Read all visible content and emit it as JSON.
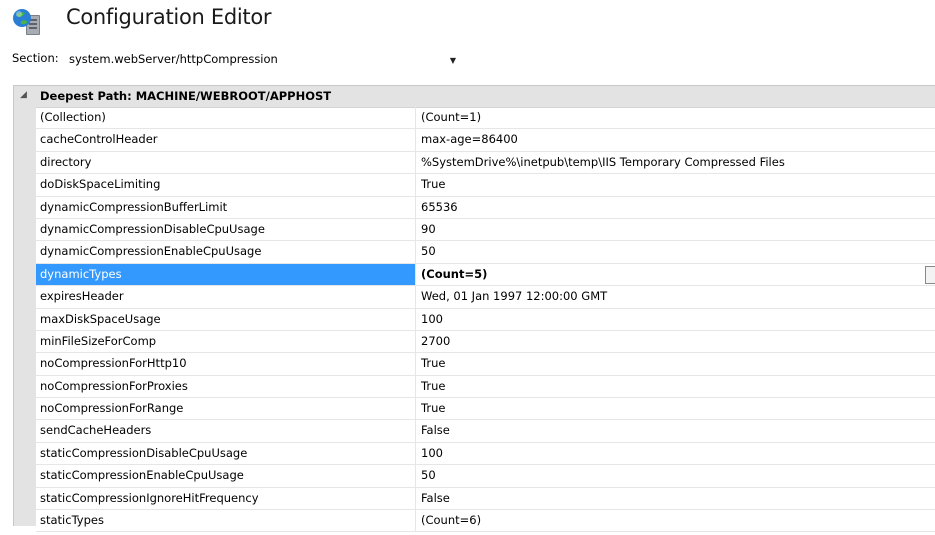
{
  "header": {
    "title": "Configuration Editor",
    "icon": "iis-config-icon"
  },
  "section": {
    "label": "Section:",
    "value": "system.webServer/httpCompression"
  },
  "grid": {
    "group": {
      "label": "Deepest Path: MACHINE/WEBROOT/APPHOST"
    },
    "selected_index": 7,
    "rows": [
      {
        "name": "(Collection)",
        "value": "(Count=1)"
      },
      {
        "name": "cacheControlHeader",
        "value": "max-age=86400"
      },
      {
        "name": "directory",
        "value": "%SystemDrive%\\inetpub\\temp\\IIS Temporary Compressed Files"
      },
      {
        "name": "doDiskSpaceLimiting",
        "value": "True"
      },
      {
        "name": "dynamicCompressionBufferLimit",
        "value": "65536"
      },
      {
        "name": "dynamicCompressionDisableCpuUsage",
        "value": "90"
      },
      {
        "name": "dynamicCompressionEnableCpuUsage",
        "value": "50"
      },
      {
        "name": "dynamicTypes",
        "value": "(Count=5)"
      },
      {
        "name": "expiresHeader",
        "value": "Wed, 01 Jan 1997 12:00:00 GMT"
      },
      {
        "name": "maxDiskSpaceUsage",
        "value": "100"
      },
      {
        "name": "minFileSizeForComp",
        "value": "2700"
      },
      {
        "name": "noCompressionForHttp10",
        "value": "True"
      },
      {
        "name": "noCompressionForProxies",
        "value": "True"
      },
      {
        "name": "noCompressionForRange",
        "value": "True"
      },
      {
        "name": "sendCacheHeaders",
        "value": "False"
      },
      {
        "name": "staticCompressionDisableCpuUsage",
        "value": "100"
      },
      {
        "name": "staticCompressionEnableCpuUsage",
        "value": "50"
      },
      {
        "name": "staticCompressionIgnoreHitFrequency",
        "value": "False"
      },
      {
        "name": "staticTypes",
        "value": "(Count=6)"
      }
    ]
  },
  "colors": {
    "selection": "#3399ff",
    "group_background": "#e3e3e3"
  }
}
